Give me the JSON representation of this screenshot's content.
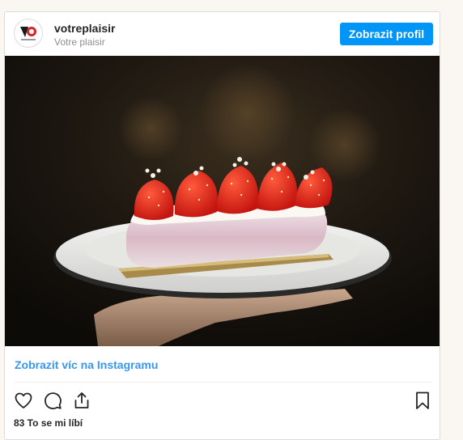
{
  "post": {
    "username": "votreplaisir",
    "display_name": "Votre plaisir",
    "profile_button": "Zobrazit profil",
    "view_more_link": "Zobrazit víc na Instagramu",
    "likes_text": "83 To se mi líbí",
    "avatar_icon": "votreplaisir-logo",
    "photo": "eclair-with-strawberries-on-plate"
  },
  "actions": {
    "like_icon": "heart-icon",
    "comment_icon": "comment-icon",
    "share_icon": "share-icon",
    "save_icon": "bookmark-icon"
  },
  "colors": {
    "accent": "#0095f6",
    "link": "#3897f0",
    "text": "#262626",
    "muted": "#8e8e8e",
    "border": "#dbdbdb"
  }
}
